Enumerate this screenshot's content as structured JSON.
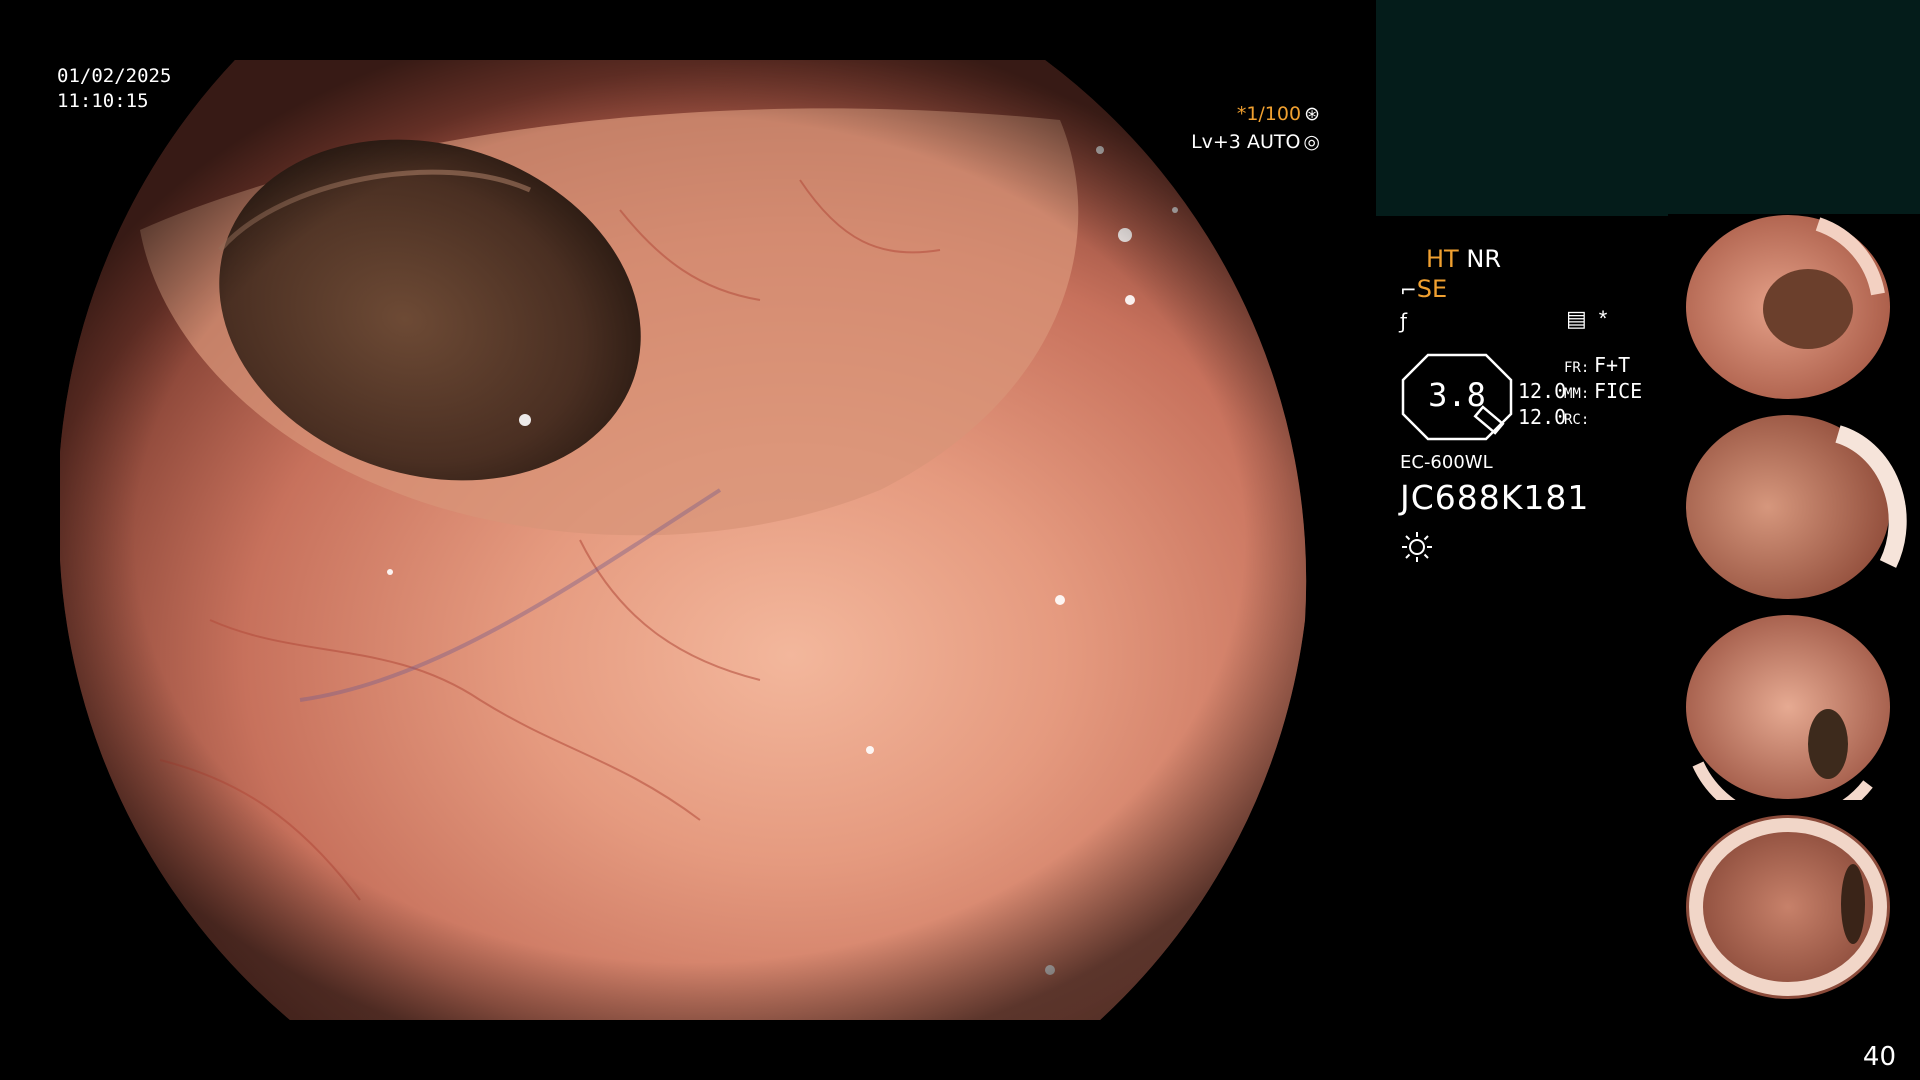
{
  "overlay": {
    "date": "01/02/2025",
    "time": "11:10:15",
    "shutter_speed": "*1/100",
    "shutter_icon": "aperture-icon",
    "level": "Lv+3 AUTO",
    "level_icon": "brightness-ring-icon"
  },
  "status": {
    "ht": "HT",
    "nr": "NR",
    "se": "SE",
    "se_icon": "structure-enhancement-icon",
    "fn_icon": "function-icon",
    "settings_icon": "memo-icon",
    "star": "*"
  },
  "gauge": {
    "value": "3.8"
  },
  "params": {
    "fr_num": "12.0",
    "mm_num": "12.0",
    "fr_label": "FR:",
    "mm_label": "MM:",
    "rc_label": "RC:",
    "fr_value": "F+T",
    "mm_value": "FICE"
  },
  "scope": {
    "model": "EC-600WL",
    "serial": "JC688K181",
    "light_icon": "light-source-icon"
  },
  "thumbnails": [
    {
      "name": "thumbnail-1"
    },
    {
      "name": "thumbnail-2"
    },
    {
      "name": "thumbnail-3"
    },
    {
      "name": "thumbnail-4"
    }
  ],
  "page_number": "40",
  "colors": {
    "orange": "#f0a030",
    "panel": "#041c1a",
    "mucosa": "#d9826a"
  }
}
